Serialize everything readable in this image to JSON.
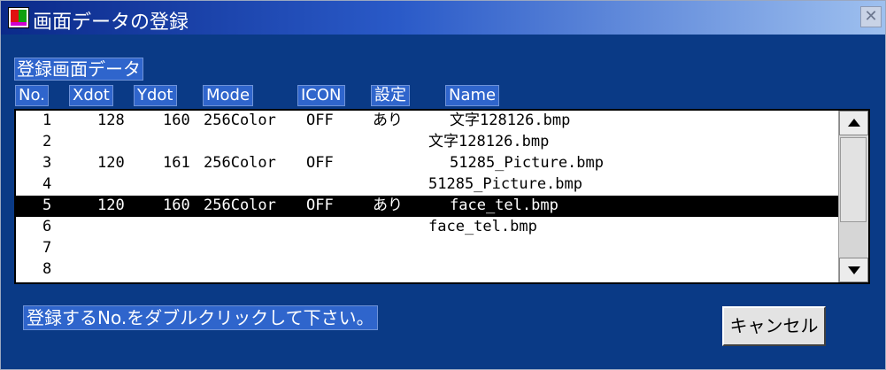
{
  "window": {
    "title": "画面データの登録",
    "close_glyph": "✕"
  },
  "section_label": "登録画面データ",
  "columns": {
    "no": "No.",
    "xdot": "Xdot",
    "ydot": "Ydot",
    "mode": "Mode",
    "icon": "ICON",
    "settei": "設定",
    "name": "Name"
  },
  "rows": [
    {
      "no": "1",
      "xdot": "128",
      "ydot": "160",
      "mode": "256Color",
      "icon": "OFF",
      "settei": "あり",
      "name": "文字128126.bmp"
    },
    {
      "no": "2",
      "xdot": "",
      "ydot": "",
      "mode": "",
      "icon": "",
      "settei": "",
      "name": "文字128126.bmp"
    },
    {
      "no": "3",
      "xdot": "120",
      "ydot": "161",
      "mode": "256Color",
      "icon": "OFF",
      "settei": "",
      "name": "51285_Picture.bmp"
    },
    {
      "no": "4",
      "xdot": "",
      "ydot": "",
      "mode": "",
      "icon": "",
      "settei": "",
      "name": "51285_Picture.bmp"
    },
    {
      "no": "5",
      "xdot": "120",
      "ydot": "160",
      "mode": "256Color",
      "icon": "OFF",
      "settei": "あり",
      "name": "face_tel.bmp"
    },
    {
      "no": "6",
      "xdot": "",
      "ydot": "",
      "mode": "",
      "icon": "",
      "settei": "",
      "name": "face_tel.bmp"
    },
    {
      "no": "7",
      "xdot": "",
      "ydot": "",
      "mode": "",
      "icon": "",
      "settei": "",
      "name": ""
    },
    {
      "no": "8",
      "xdot": "",
      "ydot": "",
      "mode": "",
      "icon": "",
      "settei": "",
      "name": ""
    }
  ],
  "selected_row": "5",
  "hint": "登録するNo.をダブルクリックして下さい。",
  "cancel_label": "キャンセル",
  "colors": {
    "window_bg": "#0a3a86",
    "label_bg": "#2f65cc",
    "selection": "#000000"
  }
}
